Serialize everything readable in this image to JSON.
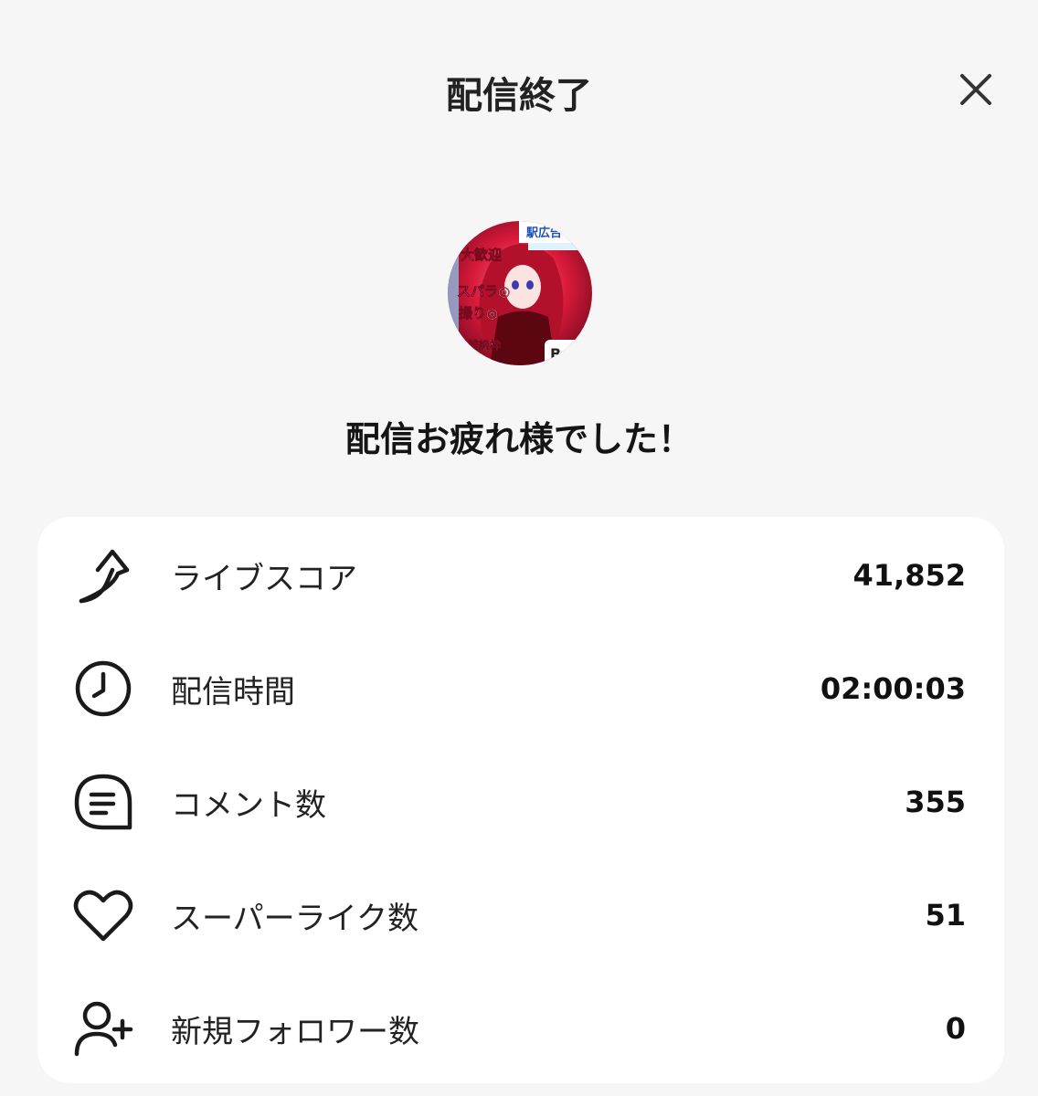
{
  "header": {
    "title": "配信終了",
    "close_icon": "close-icon"
  },
  "avatar": {
    "overlay_texts": [
      "駅広告",
      "大歓迎",
      "スパラ◎",
      "撮り◎",
      "雑談枠",
      "Be"
    ]
  },
  "message": "配信お疲れ様でした！",
  "stats": [
    {
      "icon": "trending-arrow-icon",
      "label": "ライブスコア",
      "value": "41,852"
    },
    {
      "icon": "clock-icon",
      "label": "配信時間",
      "value": "02:00:03"
    },
    {
      "icon": "comment-icon",
      "label": "コメント数",
      "value": "355"
    },
    {
      "icon": "heart-icon",
      "label": "スーパーライク数",
      "value": "51"
    },
    {
      "icon": "add-user-icon",
      "label": "新規フォロワー数",
      "value": "0"
    }
  ],
  "colors": {
    "background": "#f6f6f6",
    "card": "#ffffff",
    "text": "#1a1a1a",
    "avatar_accent": "#d81a3a"
  }
}
